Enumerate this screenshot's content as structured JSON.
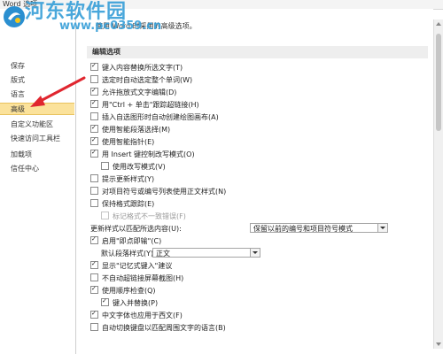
{
  "window": {
    "title": "Word 选项"
  },
  "watermark": {
    "brand": "河东软件园",
    "url": "www.pc0359.cn"
  },
  "sidebar": {
    "items": [
      {
        "label": "保存"
      },
      {
        "label": "版式"
      },
      {
        "label": "语言"
      },
      {
        "label": "高级"
      },
      {
        "label": "自定义功能区"
      },
      {
        "label": "快速访问工具栏"
      },
      {
        "label": "加载项"
      },
      {
        "label": "信任中心"
      }
    ],
    "selected_index": 3
  },
  "main": {
    "intro": "使用 Word 时采用的高级选项。",
    "section_header": "编辑选项",
    "options": [
      {
        "label": "键入内容替换所选文字(T)",
        "checked": true
      },
      {
        "label": "选定时自动选定整个单词(W)",
        "checked": false
      },
      {
        "label": "允许拖放式文字编辑(D)",
        "checked": true
      },
      {
        "label": "用\"Ctrl + 单击\"跟踪超链接(H)",
        "checked": true
      },
      {
        "label": "插入自选图形时自动创建绘图画布(A)",
        "checked": false
      },
      {
        "label": "使用智能段落选择(M)",
        "checked": true
      },
      {
        "label": "使用智能指针(E)",
        "checked": true
      },
      {
        "label": "用 Insert 键控制改写模式(O)",
        "checked": true
      },
      {
        "label": "使用改写模式(V)",
        "checked": false
      },
      {
        "label": "提示更新样式(Y)",
        "checked": false
      },
      {
        "label": "对项目符号或编号列表使用正文样式(N)",
        "checked": false
      },
      {
        "label": "保持格式跟踪(E)",
        "checked": false
      },
      {
        "label": "标记格式不一致错误(F)",
        "checked": false,
        "disabled": true
      }
    ],
    "update_style": {
      "label": "更新样式以匹配所选内容(U):",
      "value": "保留以前的编号和项目符号模式"
    },
    "options2": [
      {
        "label": "启用\"即点即输\"(C)",
        "checked": true
      }
    ],
    "default_para": {
      "label": "默认段落样式(Y):",
      "value": "正文"
    },
    "options3": [
      {
        "label": "显示\"记忆式键入\"建议",
        "checked": true
      },
      {
        "label": "不自动超链接屏幕截图(H)",
        "checked": false
      },
      {
        "label": "使用顺序检查(Q)",
        "checked": true
      },
      {
        "label": "键入并替换(P)",
        "checked": true
      },
      {
        "label": "中文字体也应用于西文(F)",
        "checked": true
      },
      {
        "label": "自动切换键盘以匹配周围文字的语言(B)",
        "checked": false
      }
    ]
  },
  "colors": {
    "selected_nav_bg": "#fbe29b",
    "watermark": "#3aa0d8",
    "arrow": "#e0262f"
  }
}
